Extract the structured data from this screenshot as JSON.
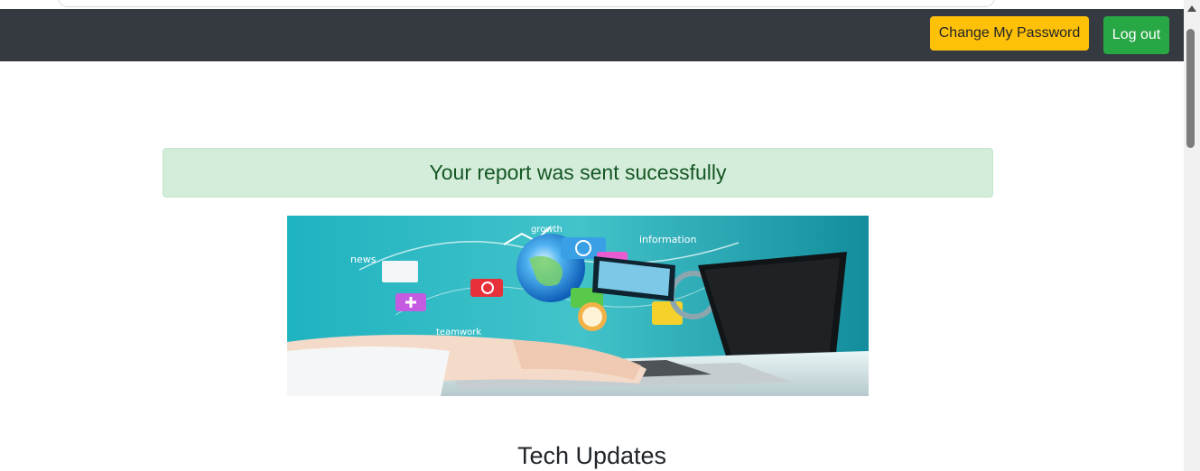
{
  "navbar": {
    "change_password_label": "Change My Password",
    "logout_label": "Log out",
    "background_color": "#343a40",
    "change_password_color": "#ffc107",
    "logout_color": "#28a745"
  },
  "alert": {
    "message": "Your report was sent sucessfully",
    "background_color": "#d4edda",
    "text_color": "#155724"
  },
  "hero_image": {
    "labels": [
      "growth",
      "information",
      "news",
      "teamwork"
    ]
  },
  "section": {
    "title": "Tech Updates"
  }
}
